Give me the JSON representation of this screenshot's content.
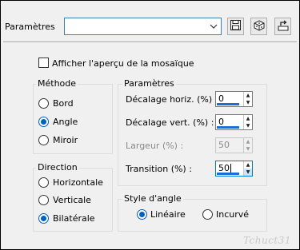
{
  "header": {
    "label": "Paramètres",
    "preset_value": ""
  },
  "preview": {
    "label": "Afficher l'aperçu de la mosaïque",
    "checked": false
  },
  "methode": {
    "title": "Méthode",
    "options": [
      "Bord",
      "Angle",
      "Miroir"
    ],
    "selected": "Angle"
  },
  "direction": {
    "title": "Direction",
    "options": [
      "Horizontale",
      "Verticale",
      "Bilatérale"
    ],
    "selected": "Bilatérale"
  },
  "parametres": {
    "title": "Paramètres",
    "fields": [
      {
        "label": "Décalage horiz. (%) :",
        "value": "0",
        "enabled": true
      },
      {
        "label": "Décalage vert. (%) :",
        "value": "0",
        "enabled": true
      },
      {
        "label": "Largeur (%) :",
        "value": "50",
        "enabled": false
      },
      {
        "label": "Transition (%) :",
        "value": "50",
        "enabled": true
      }
    ]
  },
  "style_angle": {
    "title": "Style d'angle",
    "options": [
      "Linéaire",
      "Incurvé"
    ],
    "selected": "Linéaire"
  },
  "signature": "Tchuct31",
  "colors": {
    "accent": "#0060c0",
    "background": "#f0f0f0"
  }
}
